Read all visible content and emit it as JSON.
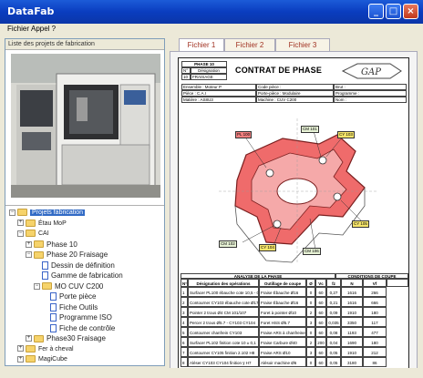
{
  "window": {
    "title": "DataFab"
  },
  "menu": {
    "items": [
      "Fichier",
      "Appel ?"
    ]
  },
  "left": {
    "header": "Liste des projets de fabrication",
    "tree": [
      {
        "label": "Projets fabrication",
        "level": 0,
        "kind": "folder",
        "expander": "−",
        "selected": true
      },
      {
        "label": "Étau MoP",
        "level": 1,
        "kind": "folder",
        "expander": "+"
      },
      {
        "label": "CAI",
        "level": 1,
        "kind": "folder",
        "expander": "−"
      },
      {
        "label": "Phase 10",
        "level": 2,
        "kind": "folder",
        "expander": "+"
      },
      {
        "label": "Phase 20 Fraisage",
        "level": 2,
        "kind": "folder",
        "expander": "−"
      },
      {
        "label": "Dessin de définition",
        "level": 3,
        "kind": "doc"
      },
      {
        "label": "Gamme de fabrication",
        "level": 3,
        "kind": "doc"
      },
      {
        "label": "MO CUV C200",
        "level": 3,
        "kind": "folder",
        "expander": "−"
      },
      {
        "label": "Porte pièce",
        "level": 4,
        "kind": "doc"
      },
      {
        "label": "Fiche Outils",
        "level": 4,
        "kind": "doc"
      },
      {
        "label": "Programme ISO",
        "level": 4,
        "kind": "doc"
      },
      {
        "label": "Fiche de contrôle",
        "level": 4,
        "kind": "doc"
      },
      {
        "label": "Phase30 Fraisage",
        "level": 2,
        "kind": "folder",
        "expander": "+"
      },
      {
        "label": "Fer à cheval",
        "level": 1,
        "kind": "folder",
        "expander": "+"
      },
      {
        "label": "MagiCube",
        "level": 1,
        "kind": "folder",
        "expander": "+"
      }
    ]
  },
  "tabs": [
    "Fichier 1",
    "Fichier 2",
    "Fichier 3"
  ],
  "sheet": {
    "phase_label": "PHASE 10",
    "col_n": "N°",
    "col_designation": "Désignation",
    "phase_num": "10",
    "phase_name": "FRAISAGE",
    "title": "CONTRAT DE PHASE",
    "logo": "GAP",
    "info": [
      [
        "Ensemble : Moteur P",
        "Code pièce :",
        "Brut :"
      ],
      [
        "Pièce : C.A.I",
        "Porte-pièce : Modulaire",
        "Programme :"
      ],
      [
        "Matière : AS8U3",
        "Machine : CUV C200",
        "Nom :"
      ]
    ],
    "callouts": [
      "CM 101",
      "CY 103",
      "PL 100",
      "CM 102",
      "CY 104",
      "CM 106",
      "CY 105"
    ],
    "analysis_title": "ANALYSE DE LA PHASE",
    "conditions_title": "CONDITIONS DE COUPE",
    "table_headers": [
      "N°",
      "Désignation des opérations",
      "Outillage de coupe",
      "Ø",
      "Vc",
      "fz",
      "N",
      "Vf"
    ],
    "rows": [
      [
        "1",
        "Surfacer PL100 ébauche cote 10,5 - 0,2",
        "Fraise Ébauche Ø16",
        "0",
        "60",
        "0,27",
        "1616",
        "266"
      ],
      [
        "2",
        "Contourner CY103 ébauche cote Ø17.7",
        "Fraise Ébauche Ø16",
        "0",
        "60",
        "0,21",
        "1616",
        "666"
      ],
      [
        "3",
        "Pointer 2 trous Ø4 CM 101/107",
        "Foret à pointer Ø10",
        "2",
        "60",
        "0,09",
        "1910",
        "180"
      ],
      [
        "4",
        "Percer 2 trous Ø5.7 - CY103 CY104",
        "Foret HSS Ø5.7",
        "3",
        "60",
        "0,035",
        "3350",
        "117"
      ],
      [
        "5",
        "Contourner chanfrein CY103",
        "Fraise ARS à chanfreiner",
        "0",
        "60",
        "0,08",
        "1193",
        "477"
      ],
      [
        "6",
        "Surfacer PL102 finition cote 10 ± 0,1",
        "Fraise Carbure Ø40",
        "2",
        "200",
        "0,04",
        "1690",
        "180"
      ],
      [
        "7",
        "Contourner CY105 finition 2.102 H8",
        "Fraise ARS Ø10",
        "3",
        "60",
        "0,05",
        "1910",
        "212"
      ],
      [
        "8",
        "Aléser CY103 CY104 finition ÿ H7",
        "Alésoir machine Ø6",
        "0",
        "60",
        "0,05",
        "3180",
        "86"
      ]
    ]
  },
  "colors": {
    "titlebar": "#0b3dbf",
    "accent_red": "#e85a5a",
    "tab_text": "#a03020"
  }
}
